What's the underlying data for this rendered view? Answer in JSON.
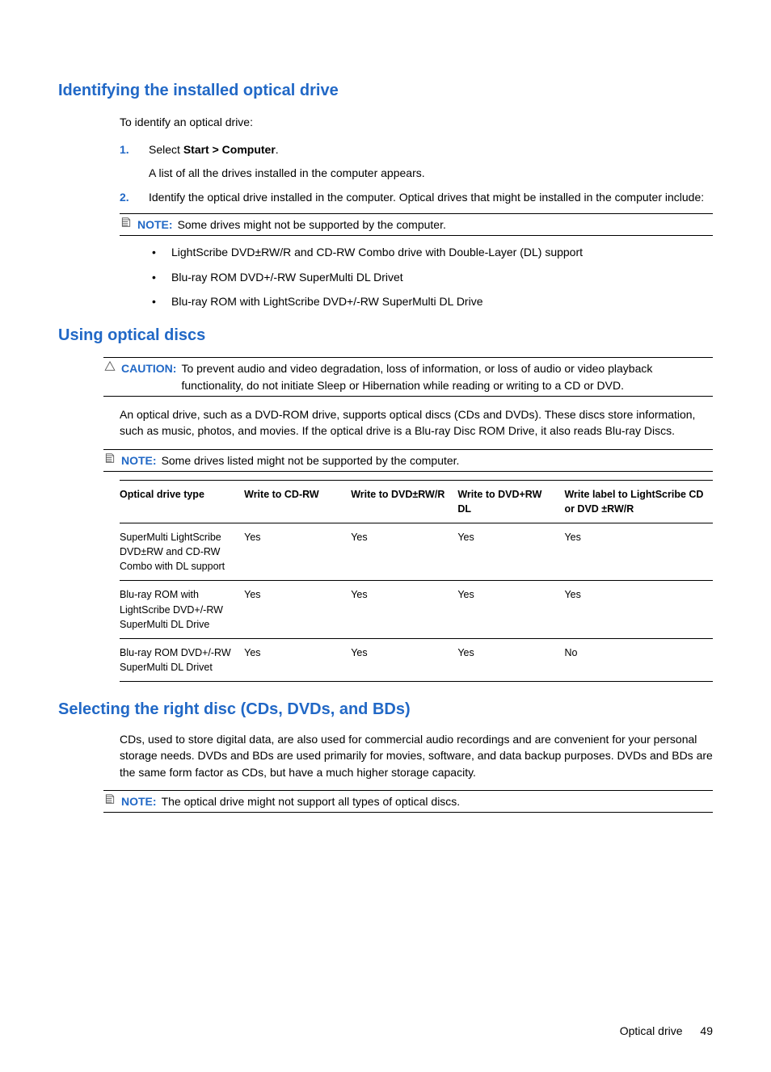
{
  "section1": {
    "heading": "Identifying the installed optical drive",
    "intro": "To identify an optical drive:",
    "steps": [
      {
        "num": "1.",
        "text_pre": "Select ",
        "bold": "Start > Computer",
        "text_post": ".",
        "sub": "A list of all the drives installed in the computer appears."
      },
      {
        "num": "2.",
        "text": "Identify the optical drive installed in the computer. Optical drives that might be installed in the computer include:"
      }
    ],
    "note_label": "NOTE:",
    "note_text": "Some drives might not be supported by the computer.",
    "bullets": [
      "LightScribe DVD±RW/R and CD-RW Combo drive with Double-Layer (DL) support",
      "Blu-ray ROM DVD+/-RW SuperMulti DL Drivet",
      "Blu-ray ROM with LightScribe DVD+/-RW SuperMulti DL Drive"
    ]
  },
  "section2": {
    "heading": "Using optical discs",
    "caution_label": "CAUTION:",
    "caution_text": "To prevent audio and video degradation, loss of information, or loss of audio or video playback functionality, do not initiate Sleep or Hibernation while reading or writing to a CD or DVD.",
    "para": "An optical drive, such as a DVD-ROM drive, supports optical discs (CDs and DVDs). These discs store information, such as music, photos, and movies. If the optical drive is a Blu-ray Disc ROM Drive, it also reads Blu-ray Discs.",
    "note_label": "NOTE:",
    "note_text": "Some drives listed might not be supported by the computer.",
    "table": {
      "headers": [
        "Optical drive type",
        "Write to CD-RW",
        "Write to DVD±RW/R",
        "Write to DVD+RW DL",
        "Write label to LightScribe CD or DVD ±RW/R"
      ],
      "rows": [
        {
          "c0": "SuperMulti LightScribe DVD±RW and CD-RW Combo with DL support",
          "c1": "Yes",
          "c2": "Yes",
          "c3": "Yes",
          "c4": "Yes"
        },
        {
          "c0": "Blu-ray ROM with LightScribe DVD+/-RW SuperMulti DL Drive",
          "c1": "Yes",
          "c2": "Yes",
          "c3": "Yes",
          "c4": "Yes"
        },
        {
          "c0": "Blu-ray ROM DVD+/-RW SuperMulti DL Drivet",
          "c1": "Yes",
          "c2": "Yes",
          "c3": "Yes",
          "c4": "No"
        }
      ]
    }
  },
  "section3": {
    "heading": "Selecting the right disc (CDs, DVDs, and BDs)",
    "para": "CDs, used to store digital data, are also used for commercial audio recordings and are convenient for your personal storage needs. DVDs and BDs are used primarily for movies, software, and data backup purposes. DVDs and BDs are the same form factor as CDs, but have a much higher storage capacity.",
    "note_label": "NOTE:",
    "note_text": "The optical drive might not support all types of optical discs."
  },
  "footer": {
    "section": "Optical drive",
    "page": "49"
  }
}
